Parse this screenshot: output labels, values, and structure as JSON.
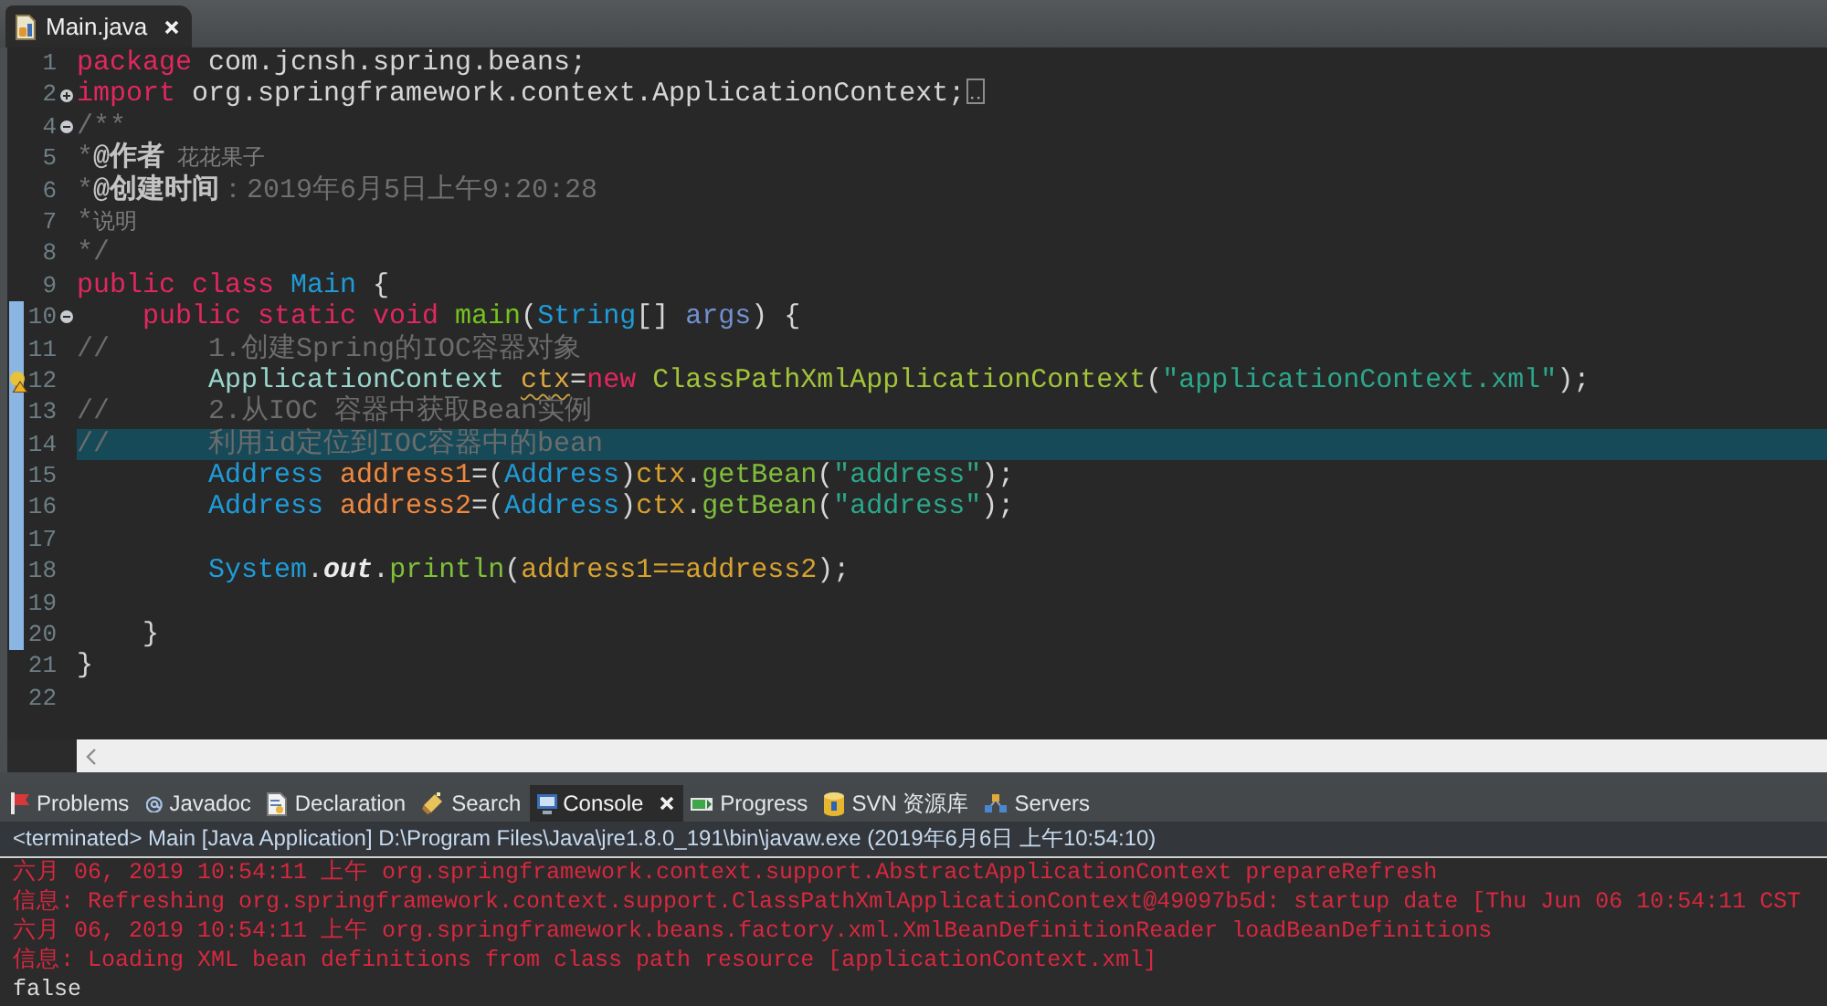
{
  "editor_tab": {
    "label": "Main.java",
    "selected": true
  },
  "lines": [
    {
      "number": "1",
      "changed": false,
      "current": false,
      "warning": false,
      "tokens": [
        {
          "text": "package",
          "kind": "keyword"
        },
        {
          "text": " com.jcnsh.spring.beans;",
          "kind": "plain"
        }
      ]
    },
    {
      "number": "2",
      "changed": false,
      "current": false,
      "warning": false,
      "expanded": false,
      "tokens": [
        {
          "text": "import",
          "kind": "keyword"
        },
        {
          "text": " org.springframework.context.ApplicationContext;",
          "kind": "plain"
        }
      ]
    },
    {
      "number": "4",
      "changed": false,
      "current": false,
      "warning": false,
      "expanded": true,
      "tokens": [
        {
          "text": "/**",
          "kind": "doc"
        }
      ]
    },
    {
      "number": "5",
      "changed": false,
      "current": false,
      "warning": false,
      "tokens": [
        {
          "text": "*",
          "kind": "doc"
        },
        {
          "text": "@作者",
          "kind": "doc-tag"
        },
        {
          "text": " 花花果子",
          "kind": "doc-note"
        }
      ]
    },
    {
      "number": "6",
      "changed": false,
      "current": false,
      "warning": false,
      "tokens": [
        {
          "text": "*",
          "kind": "doc"
        },
        {
          "text": "@创建时间",
          "kind": "doc-tag"
        },
        {
          "text": "：2019年6月5日上午9:20:28",
          "kind": "doc"
        }
      ]
    },
    {
      "number": "7",
      "changed": false,
      "current": false,
      "warning": false,
      "tokens": [
        {
          "text": "*",
          "kind": "doc"
        },
        {
          "text": "说明",
          "kind": "doc-note"
        }
      ]
    },
    {
      "number": "8",
      "changed": false,
      "current": false,
      "warning": false,
      "tokens": [
        {
          "text": "*/",
          "kind": "doc"
        }
      ]
    },
    {
      "number": "9",
      "changed": false,
      "current": false,
      "warning": false,
      "tokens": [
        {
          "text": "public class ",
          "kind": "keyword"
        },
        {
          "text": "Main",
          "kind": "type"
        },
        {
          "text": " {",
          "kind": "plain"
        }
      ]
    },
    {
      "number": "10",
      "changed": true,
      "current": false,
      "warning": false,
      "expanded": true,
      "tokens": [
        {
          "text": "\tpublic static void ",
          "kind": "keyword"
        },
        {
          "text": "main",
          "kind": "method-decl"
        },
        {
          "text": "(",
          "kind": "plain"
        },
        {
          "text": "String",
          "kind": "type"
        },
        {
          "text": "[] ",
          "kind": "plain"
        },
        {
          "text": "args",
          "kind": "param"
        },
        {
          "text": ") {",
          "kind": "plain"
        }
      ]
    },
    {
      "number": "11",
      "changed": true,
      "current": false,
      "warning": false,
      "tokens": [
        {
          "text": "//\t\t1.创建Spring的IOC容器对象",
          "kind": "comment"
        }
      ]
    },
    {
      "number": "12",
      "changed": true,
      "current": false,
      "warning": true,
      "tokens": [
        {
          "text": "\t\tApplicationContext ",
          "kind": "interface"
        },
        {
          "text": "ctx",
          "kind": "unused-local"
        },
        {
          "text": "=",
          "kind": "plain"
        },
        {
          "text": "new ",
          "kind": "keyword"
        },
        {
          "text": "ClassPathXmlApplicationContext",
          "kind": "class"
        },
        {
          "text": "(",
          "kind": "plain"
        },
        {
          "text": "\"applicationContext.xml\"",
          "kind": "string"
        },
        {
          "text": ");",
          "kind": "plain"
        }
      ]
    },
    {
      "number": "13",
      "changed": true,
      "current": false,
      "warning": false,
      "tokens": [
        {
          "text": "//\t\t2.从IOC 容器中获取Bean实例",
          "kind": "comment"
        }
      ]
    },
    {
      "number": "14",
      "changed": true,
      "current": true,
      "warning": false,
      "tokens": [
        {
          "text": "//\t\t利用id定位到IOC容器中的bean",
          "kind": "comment"
        }
      ]
    },
    {
      "number": "15",
      "changed": true,
      "current": false,
      "warning": false,
      "tokens": [
        {
          "text": "\t\tAddress ",
          "kind": "type"
        },
        {
          "text": "address1",
          "kind": "local-decl"
        },
        {
          "text": "=(",
          "kind": "plain"
        },
        {
          "text": "Address",
          "kind": "type"
        },
        {
          "text": ")",
          "kind": "plain"
        },
        {
          "text": "ctx",
          "kind": "local"
        },
        {
          "text": ".",
          "kind": "plain"
        },
        {
          "text": "getBean",
          "kind": "method"
        },
        {
          "text": "(",
          "kind": "plain"
        },
        {
          "text": "\"address\"",
          "kind": "string"
        },
        {
          "text": ");",
          "kind": "plain"
        }
      ]
    },
    {
      "number": "16",
      "changed": true,
      "current": false,
      "warning": false,
      "tokens": [
        {
          "text": "\t\tAddress ",
          "kind": "type"
        },
        {
          "text": "address2",
          "kind": "local-decl"
        },
        {
          "text": "=(",
          "kind": "plain"
        },
        {
          "text": "Address",
          "kind": "type"
        },
        {
          "text": ")",
          "kind": "plain"
        },
        {
          "text": "ctx",
          "kind": "local"
        },
        {
          "text": ".",
          "kind": "plain"
        },
        {
          "text": "getBean",
          "kind": "method"
        },
        {
          "text": "(",
          "kind": "plain"
        },
        {
          "text": "\"address\"",
          "kind": "string"
        },
        {
          "text": ");",
          "kind": "plain"
        }
      ]
    },
    {
      "number": "17",
      "changed": true,
      "current": false,
      "warning": false
    },
    {
      "number": "18",
      "changed": true,
      "current": false,
      "warning": false,
      "tokens": [
        {
          "text": "\t\tSystem",
          "kind": "type"
        },
        {
          "text": ".",
          "kind": "plain"
        },
        {
          "text": "out",
          "kind": "static-field"
        },
        {
          "text": ".",
          "kind": "plain"
        },
        {
          "text": "println",
          "kind": "method"
        },
        {
          "text": "(",
          "kind": "plain"
        },
        {
          "text": "address1==address2",
          "kind": "local"
        },
        {
          "text": ");",
          "kind": "plain"
        }
      ]
    },
    {
      "number": "19",
      "changed": true,
      "current": false,
      "warning": false
    },
    {
      "number": "20",
      "changed": true,
      "current": false,
      "warning": false,
      "tokens": [
        {
          "text": "\t}",
          "kind": "plain"
        }
      ]
    },
    {
      "number": "21",
      "changed": false,
      "current": false,
      "warning": false,
      "tokens": [
        {
          "text": "}",
          "kind": "plain"
        }
      ]
    },
    {
      "number": "22",
      "changed": false,
      "current": false,
      "warning": false
    }
  ],
  "panel_tabs": [
    {
      "label": "Problems",
      "selected": false
    },
    {
      "label": "Javadoc",
      "selected": false
    },
    {
      "label": "Declaration",
      "selected": false
    },
    {
      "label": "Search",
      "selected": false
    },
    {
      "label": "Console",
      "selected": true
    },
    {
      "label": "Progress",
      "selected": false
    },
    {
      "label": "SVN 资源库",
      "selected": false
    },
    {
      "label": "Servers",
      "selected": false
    }
  ],
  "console": {
    "header": "<terminated> Main [Java Application] D:\\Program Files\\Java\\jre1.8.0_191\\bin\\javaw.exe (2019年6月6日 上午10:54:10)",
    "lines": [
      {
        "text": "六月 06, 2019 10:54:11 上午 org.springframework.context.support.AbstractApplicationContext prepareRefresh",
        "kind": "stderr"
      },
      {
        "text": "信息: Refreshing org.springframework.context.support.ClassPathXmlApplicationContext@49097b5d: startup date [Thu Jun 06 10:54:11 CST",
        "kind": "stderr"
      },
      {
        "text": "六月 06, 2019 10:54:11 上午 org.springframework.beans.factory.xml.XmlBeanDefinitionReader loadBeanDefinitions",
        "kind": "stderr"
      },
      {
        "text": "信息: Loading XML bean definitions from class path resource [applicationContext.xml]",
        "kind": "stderr"
      },
      {
        "text": "false",
        "kind": "stdout"
      }
    ]
  }
}
